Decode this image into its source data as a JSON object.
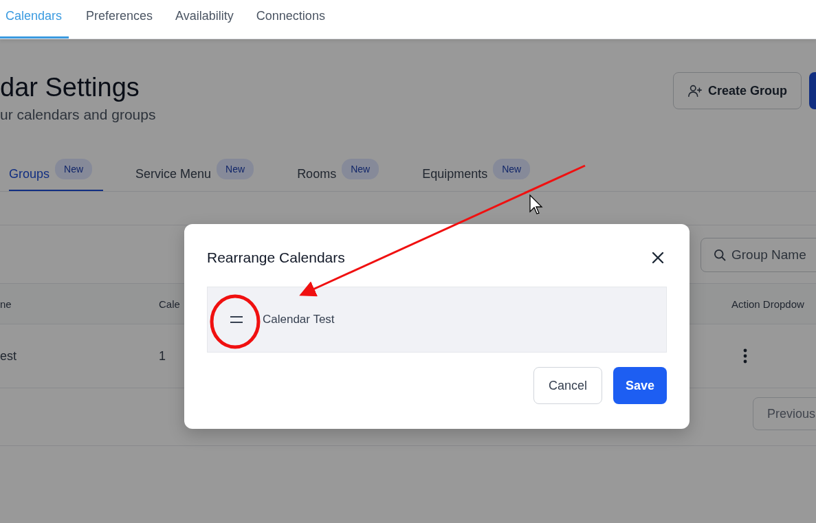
{
  "nav_tabs": [
    {
      "label": "Calendars",
      "selected": true
    },
    {
      "label": "Preferences",
      "selected": false
    },
    {
      "label": "Availability",
      "selected": false
    },
    {
      "label": "Connections",
      "selected": false
    }
  ],
  "header": {
    "title": "dar Settings",
    "subtitle": "ur calendars and groups",
    "create_group_button": "Create Group"
  },
  "section_tabs": [
    {
      "label": "Groups",
      "badge": "New",
      "selected": true
    },
    {
      "label": "Service Menu",
      "badge": "New",
      "selected": false
    },
    {
      "label": "Rooms",
      "badge": "New",
      "selected": false
    },
    {
      "label": "Equipments",
      "badge": "New",
      "selected": false
    }
  ],
  "search": {
    "placeholder": "Group Name"
  },
  "table": {
    "columns": [
      "ne",
      "Cale",
      "Action Dropdow"
    ],
    "rows": [
      {
        "cells": [
          "est",
          "1"
        ]
      }
    ]
  },
  "pagination": {
    "previous_button": "Previous"
  },
  "modal": {
    "title": "Rearrange Calendars",
    "items": [
      {
        "label": "Calendar Test"
      }
    ],
    "cancel_button": "Cancel",
    "save_button": "Save"
  }
}
